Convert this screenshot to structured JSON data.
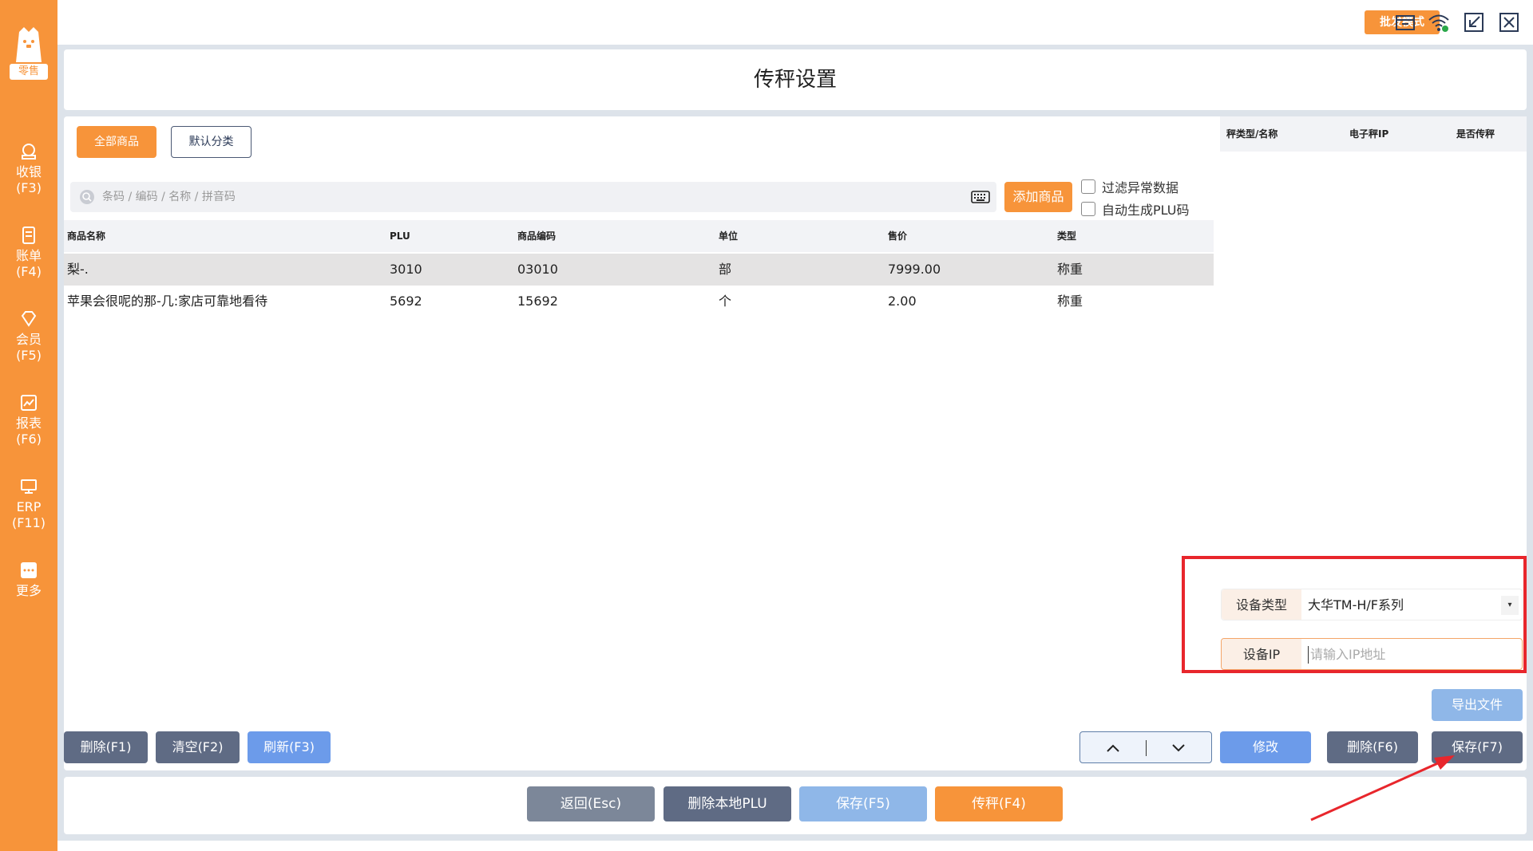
{
  "sidebar": {
    "logo_label": "零售",
    "items": [
      {
        "label": "收银",
        "key": "(F3)"
      },
      {
        "label": "账单",
        "key": "(F4)"
      },
      {
        "label": "会员",
        "key": "(F5)"
      },
      {
        "label": "报表",
        "key": "(F6)"
      },
      {
        "label": "ERP",
        "key": "(F11)"
      },
      {
        "label": "更多",
        "key": ""
      }
    ]
  },
  "topbar": {
    "wholesale_label": "批发模式"
  },
  "page": {
    "title": "传秤设置"
  },
  "categories": {
    "all": "全部商品",
    "default": "默认分类"
  },
  "search": {
    "placeholder": "条码 / 编码 / 名称 / 拼音码",
    "add_label": "添加商品"
  },
  "options": {
    "filter_abnormal": "过滤异常数据",
    "auto_plu": "自动生成PLU码"
  },
  "table": {
    "headers": [
      "商品名称",
      "PLU",
      "商品编码",
      "单位",
      "售价",
      "类型"
    ],
    "rows": [
      [
        "梨-.",
        "3010",
        "03010",
        "部",
        "7999.00",
        "称重"
      ],
      [
        "苹果会很呢的那-几:家店可靠地看待",
        "5692",
        "15692",
        "个",
        "2.00",
        "称重"
      ]
    ]
  },
  "right_panel": {
    "headers": [
      "秤类型/名称",
      "电子秤IP",
      "是否传秤"
    ],
    "device_type_label": "设备类型",
    "device_type_value": "大华TM-H/F系列",
    "device_ip_label": "设备IP",
    "device_ip_placeholder": "请输入IP地址",
    "export_label": "导出文件"
  },
  "buttons": {
    "delete": "删除(F1)",
    "clear": "清空(F2)",
    "refresh": "刷新(F3)",
    "modify": "修改",
    "delete_f6": "删除(F6)",
    "save_f7": "保存(F7)"
  },
  "action_bar": {
    "back": "返回(Esc)",
    "delete_local_plu": "删除本地PLU",
    "save_f5": "保存(F5)",
    "transfer": "传秤(F4)"
  },
  "colors": {
    "accent": "#f7943a",
    "dark_button": "#5f6b84",
    "blue_button": "#6c9bea",
    "annotation_red": "#e8262c"
  }
}
